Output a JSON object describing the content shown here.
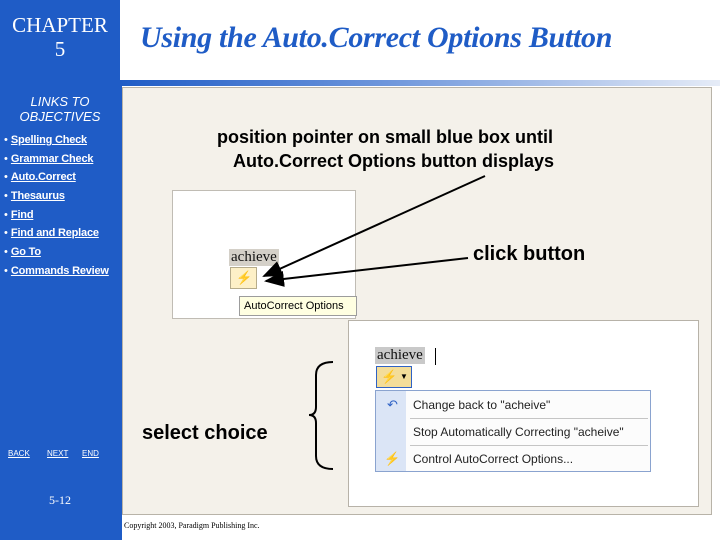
{
  "sidebar": {
    "chapter_line1": "CHAPTER",
    "chapter_line2": "5",
    "links_title_line1": "LINKS TO",
    "links_title_line2": "OBJECTIVES",
    "links": [
      "Spelling Check",
      "Grammar Check",
      "Auto.Correct",
      "Thesaurus",
      "Find",
      "Find and Replace",
      "Go To",
      "Commands Review"
    ],
    "nav": {
      "back": "BACK",
      "next": "NEXT",
      "end": "END"
    },
    "page_number": "5-12",
    "color": "#1f5cc6"
  },
  "title": "Using the Auto.Correct Options Button",
  "callouts": {
    "position_line1": "position pointer on small blue box until",
    "position_line2": "Auto.Correct Options button displays",
    "click": "click button",
    "select": "select choice"
  },
  "screenshot": {
    "word": "achieve",
    "tooltip": "AutoCorrect Options",
    "menu_items": [
      {
        "label": "Change back to \"acheive\"",
        "icon": "undo-icon"
      },
      {
        "label": "Stop Automatically Correcting \"acheive\"",
        "icon": "none"
      },
      {
        "label": "Control AutoCorrect Options...",
        "icon": "lightning-icon"
      }
    ]
  },
  "copyright": "Copyright 2003, Paradigm Publishing Inc."
}
